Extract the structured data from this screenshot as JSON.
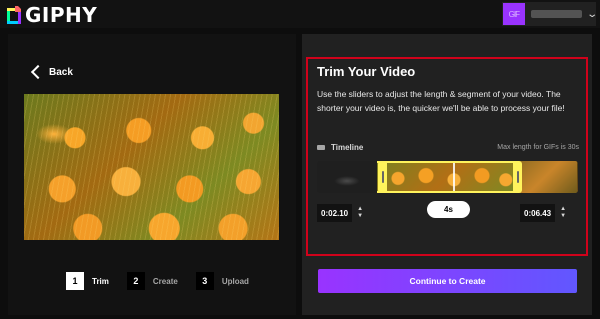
{
  "brand": {
    "name": "GIPHY"
  },
  "account": {
    "avatar_text": "GIF",
    "username": "",
    "menu_icon": "chevron-down-icon"
  },
  "nav": {
    "back_label": "Back"
  },
  "steps": [
    {
      "number": "1",
      "label": "Trim",
      "active": true
    },
    {
      "number": "2",
      "label": "Create",
      "active": false
    },
    {
      "number": "3",
      "label": "Upload",
      "active": false
    }
  ],
  "trim": {
    "title": "Trim Your Video",
    "description": "Use the sliders to adjust the length & segment of your video. The shorter your video is, the quicker we'll be able to process your file!",
    "timeline_label": "Timeline",
    "max_length": "Max length for GIFs is 30s",
    "start_time": "0:02.10",
    "end_time": "0:06.43",
    "duration": "4s"
  },
  "actions": {
    "continue_label": "Continue to Create"
  },
  "colors": {
    "accent": "#9933ff",
    "accent_end": "#6157ff",
    "handle": "#fff35c",
    "highlight": "#d0021b"
  }
}
